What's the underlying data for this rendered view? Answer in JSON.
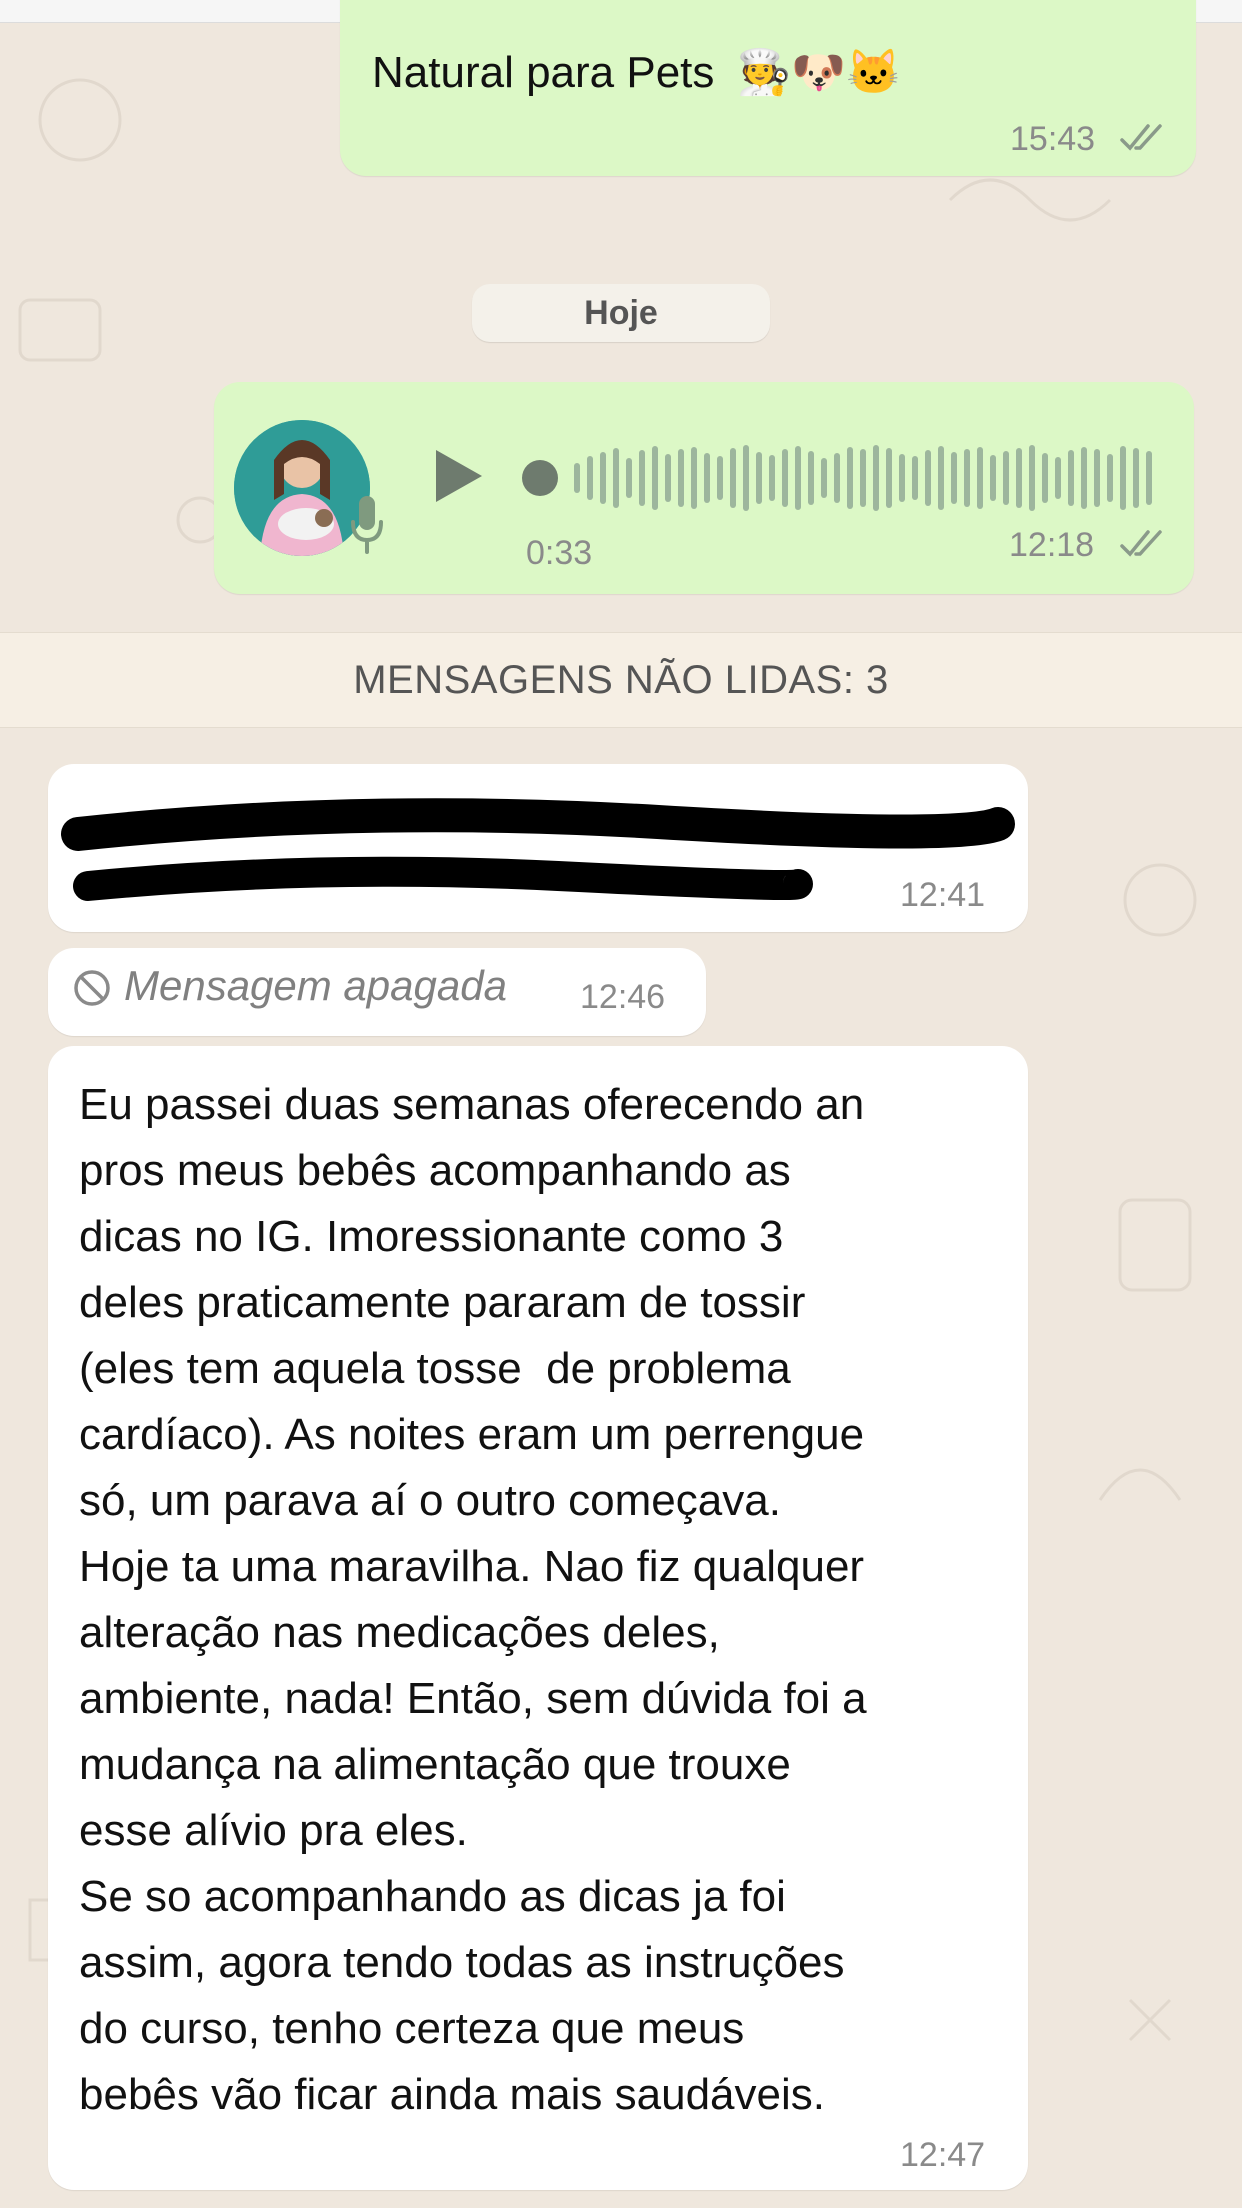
{
  "chat": {
    "sent_text_line": "Natural para Pets",
    "sent_emojis": "🧑‍🍳🐶🐱",
    "sent_time": "15:43",
    "date_separator": "Hoje",
    "audio": {
      "duration": "0:33",
      "time": "12:18",
      "progress": 0
    },
    "unread_banner": "MENSAGENS NÃO LIDAS: 3",
    "redacted_time": "12:41",
    "deleted": {
      "label": "Mensagem apagada",
      "time": "12:46"
    },
    "long_message": {
      "text": "Eu passei duas semanas oferecendo an\npros meus bebês acompanhando as\ndicas no IG. Imoressionante como 3\ndeles praticamente pararam de tossir\n(eles tem aquela tosse  de problema\ncardíaco). As noites eram um perrengue\nsó, um parava aí o outro começava.\nHoje ta uma maravilha. Nao fiz qualquer\nalteração nas medicações deles,\nambiente, nada! Então, sem dúvida foi a\nmudança na alimentação que trouxe\nesse alívio pra eles.\nSe so acompanhando as dicas ja foi\nassim, agora tendo todas as instruções\ndo curso, tenho certeza que meus\nbebês vão ficar ainda mais saudáveis.",
      "time": "12:47"
    }
  },
  "colors": {
    "outgoing_bubble": "#dcf8c6",
    "incoming_bubble": "#ffffff",
    "background": "#efe7dd",
    "read_ticks": "#8a9a8a"
  }
}
